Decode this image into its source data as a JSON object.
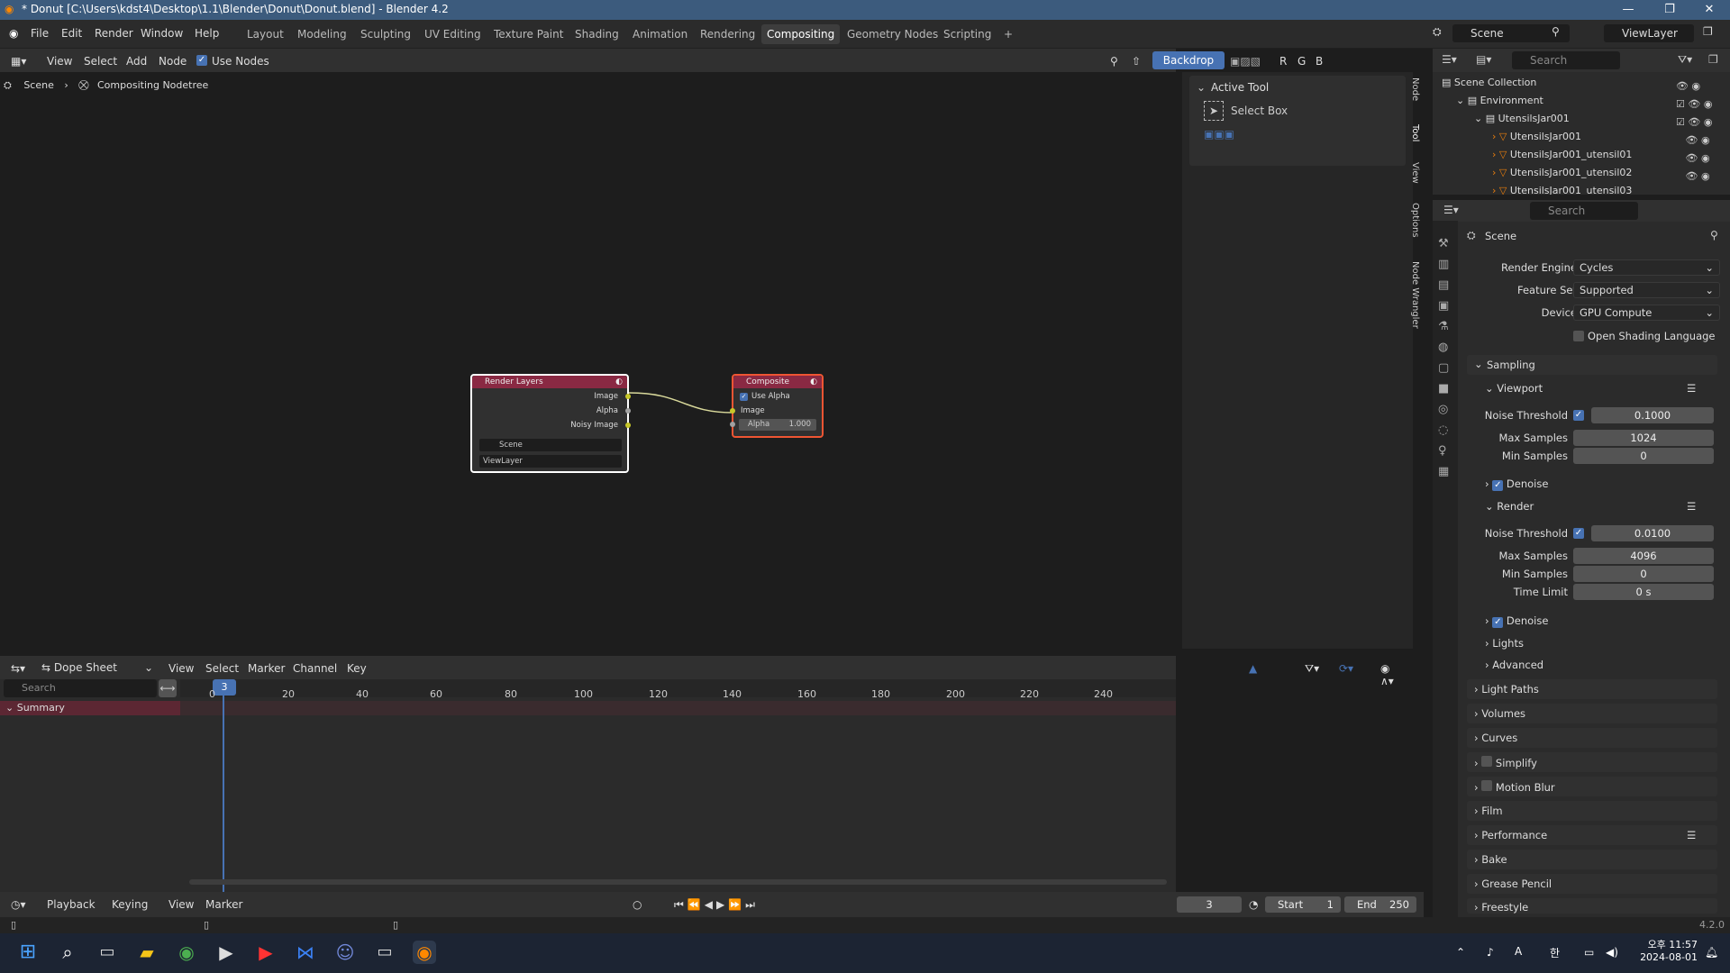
{
  "title_bar": {
    "title": "* Donut [C:\\Users\\kdst4\\Desktop\\1.1\\Blender\\Donut\\Donut.blend] - Blender 4.2"
  },
  "menus": [
    "File",
    "Edit",
    "Render",
    "Window",
    "Help"
  ],
  "workspaces": [
    "Layout",
    "Modeling",
    "Sculpting",
    "UV Editing",
    "Texture Paint",
    "Shading",
    "Animation",
    "Rendering",
    "Compositing",
    "Geometry Nodes",
    "Scripting"
  ],
  "active_workspace": "Compositing",
  "scene_field": "Scene",
  "viewlayer_field": "ViewLayer",
  "node_header": {
    "view": "View",
    "select": "Select",
    "add": "Add",
    "node": "Node",
    "use_nodes": "Use Nodes",
    "backdrop": "Backdrop",
    "channels": [
      "R",
      "G",
      "B"
    ]
  },
  "breadcrumb": {
    "scene": "Scene",
    "tree": "Compositing Nodetree"
  },
  "nodes": {
    "render_layers": {
      "title": "Render Layers",
      "outputs": [
        "Image",
        "Alpha",
        "Noisy Image"
      ],
      "scene": "Scene",
      "layer": "ViewLayer"
    },
    "composite": {
      "title": "Composite",
      "use_alpha": "Use Alpha",
      "image": "Image",
      "alpha_label": "Alpha",
      "alpha_value": "1.000"
    }
  },
  "sidebar": {
    "section": "Active Tool",
    "tool": "Select Box",
    "tabs": [
      "Node",
      "Tool",
      "View",
      "Options",
      "Node Wrangler"
    ]
  },
  "outliner": {
    "search_placeholder": "Search",
    "rows": [
      "Scene Collection",
      "Environment",
      "UtensilsJar001",
      "UtensilsJar001",
      "UtensilsJar001_utensil01",
      "UtensilsJar001_utensil02",
      "UtensilsJar001_utensil03"
    ]
  },
  "properties": {
    "search_placeholder": "Search",
    "context": "Scene",
    "render_engine_label": "Render Engine",
    "render_engine": "Cycles",
    "feature_set_label": "Feature Set",
    "feature_set": "Supported",
    "device_label": "Device",
    "device": "GPU Compute",
    "osl_label": "Open Shading Language",
    "sampling": "Sampling",
    "viewport": "Viewport",
    "noise_threshold_label": "Noise Threshold",
    "max_samples_label": "Max Samples",
    "min_samples_label": "Min Samples",
    "time_limit_label": "Time Limit",
    "viewport_noise": "0.1000",
    "viewport_max": "1024",
    "viewport_min": "0",
    "denoise": "Denoise",
    "render": "Render",
    "render_noise": "0.0100",
    "render_max": "4096",
    "render_min": "0",
    "render_time": "0 s",
    "lights": "Lights",
    "advanced": "Advanced",
    "panels": [
      "Light Paths",
      "Volumes",
      "Curves",
      "Simplify",
      "Motion Blur",
      "Film",
      "Performance",
      "Bake",
      "Grease Pencil",
      "Freestyle"
    ]
  },
  "dopesheet": {
    "mode": "Dope Sheet",
    "menus": [
      "View",
      "Select",
      "Marker",
      "Channel",
      "Key"
    ],
    "search_placeholder": "Search",
    "summary": "Summary",
    "ruler": [
      "0",
      "20",
      "40",
      "60",
      "80",
      "100",
      "120",
      "140",
      "160",
      "180",
      "200",
      "220",
      "240"
    ],
    "current_frame": "3"
  },
  "timeline": {
    "playback": "Playback",
    "keying": "Keying",
    "view": "View",
    "marker": "Marker",
    "frame": "3",
    "start_label": "Start",
    "start": "1",
    "end_label": "End",
    "end": "250"
  },
  "statusbar": {
    "version": "4.2.0"
  },
  "taskbar": {
    "time": "오후 11:57",
    "date": "2024-08-01",
    "ime": "A",
    "ime2": "한"
  }
}
